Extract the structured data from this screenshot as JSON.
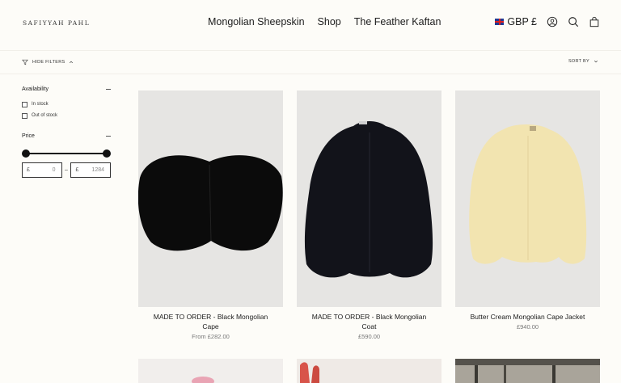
{
  "brand": {
    "logo_text": "SAFIYYAH PAHL"
  },
  "nav": {
    "items": [
      "Mongolian Sheepskin",
      "Shop",
      "The Feather Kaftan"
    ]
  },
  "header": {
    "currency": "GBP £"
  },
  "filter_bar": {
    "hide_filters": "HIDE FILTERS",
    "sort_by": "SORT BY"
  },
  "filters": {
    "availability": {
      "label": "Availability",
      "options": [
        "In stock",
        "Out of stock"
      ]
    },
    "price": {
      "label": "Price",
      "currency_symbol": "£",
      "min": "0",
      "max": "1284"
    }
  },
  "products": [
    {
      "title_line1": "MADE TO ORDER - Black Mongolian",
      "title_line2": "Cape",
      "price": "From £282.00",
      "color": "#0b0b0b"
    },
    {
      "title_line1": "MADE TO ORDER - Black Mongolian",
      "title_line2": "Coat",
      "price": "£590.00",
      "color": "#12131a"
    },
    {
      "title_line1": "Butter Cream Mongolian Cape Jacket",
      "title_line2": "",
      "price": "£940.00",
      "color": "#f2e4b0"
    }
  ],
  "colors": {
    "background": "#fdfcf8",
    "image_bg": "#e6e5e3",
    "text": "#1c1c1c"
  }
}
